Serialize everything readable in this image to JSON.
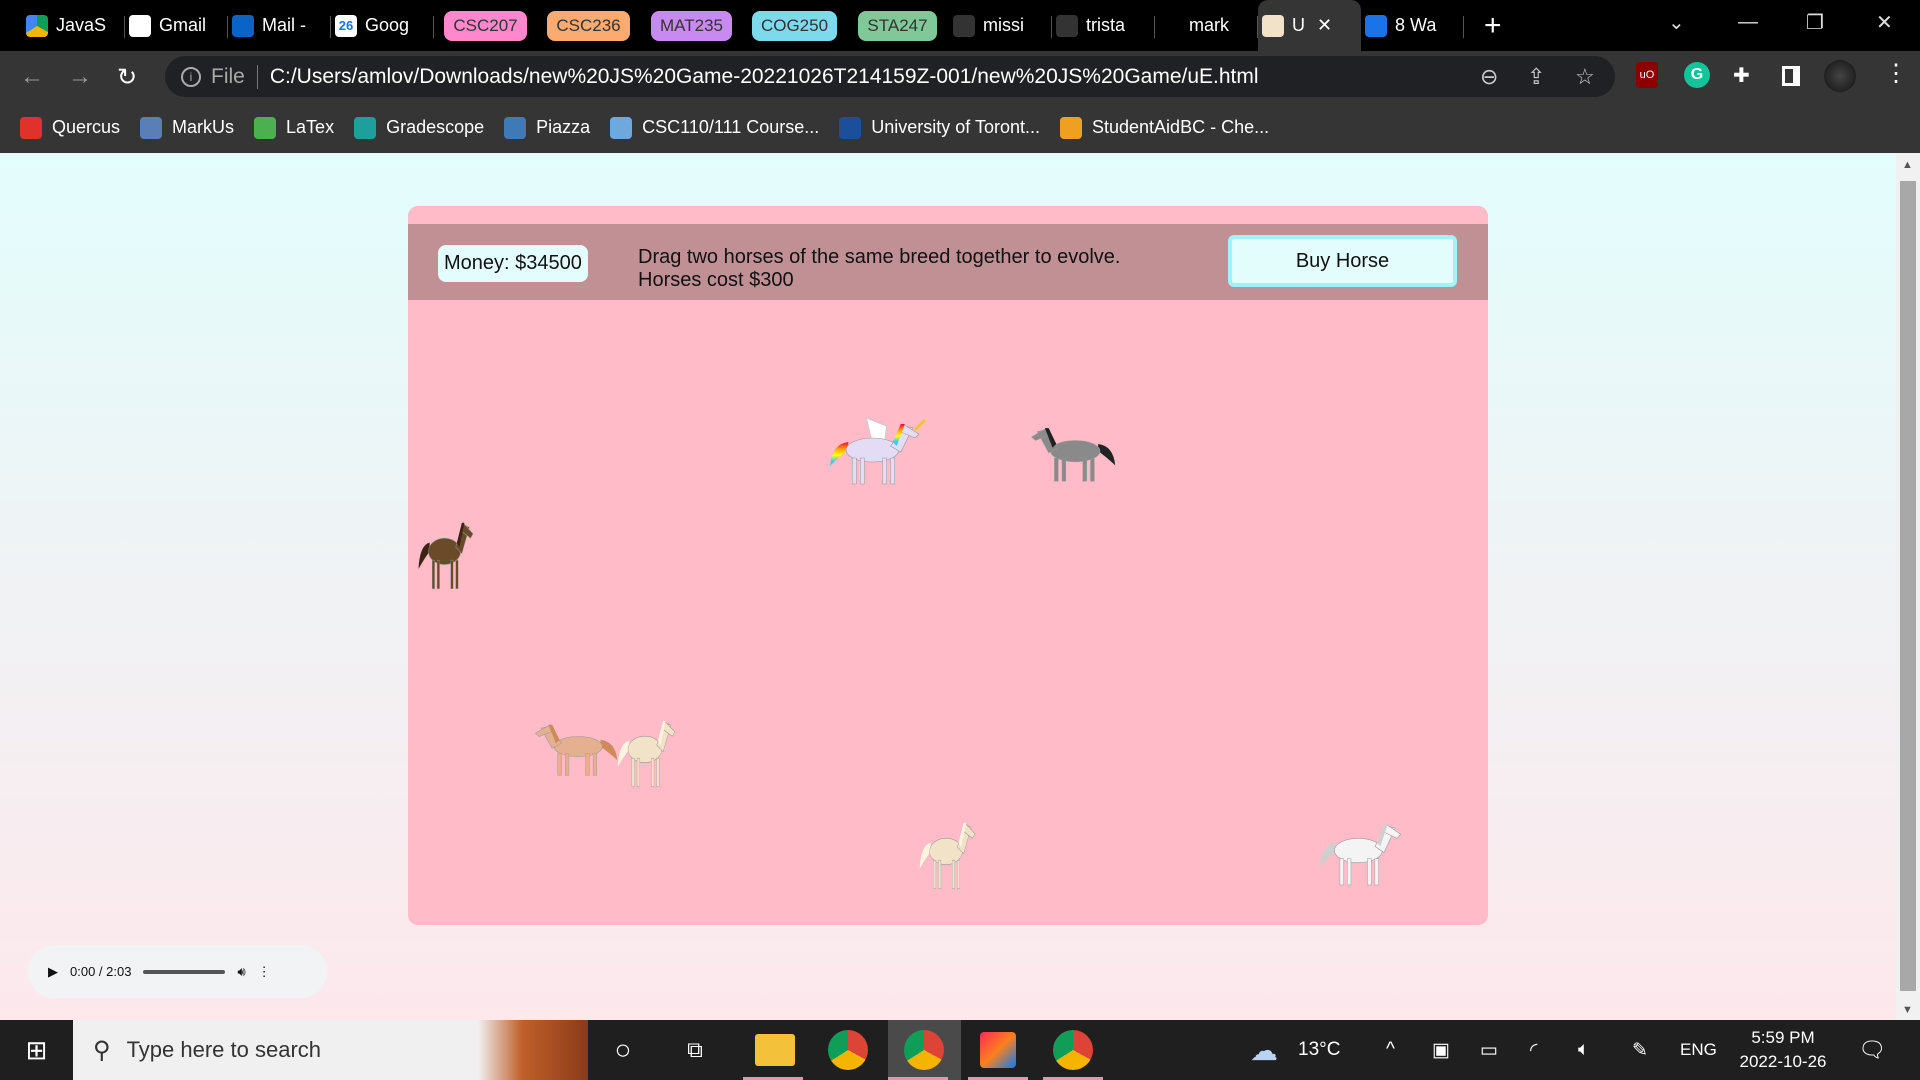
{
  "browser": {
    "tabs": [
      {
        "label": "JavaS",
        "icon": "google-drive-icon"
      },
      {
        "label": "Gmail",
        "icon": "gmail-icon"
      },
      {
        "label": "Mail -",
        "icon": "outlook-icon"
      },
      {
        "label": "Goog",
        "icon": "google-calendar-icon",
        "icon_text": "26"
      },
      {
        "label": "CSC207",
        "pill_color": "#ff88cc"
      },
      {
        "label": "CSC236",
        "pill_color": "#fcab70"
      },
      {
        "label": "MAT235",
        "pill_color": "#c88af0"
      },
      {
        "label": "COG250",
        "pill_color": "#7dd9ec"
      },
      {
        "label": "STA247",
        "pill_color": "#80c897"
      },
      {
        "label": "missi",
        "icon": "github-icon"
      },
      {
        "label": "trista",
        "icon": "github-icon"
      },
      {
        "label": "mark",
        "icon": "stackoverflow-icon"
      },
      {
        "label": "U",
        "icon": "horse-icon",
        "active": true
      },
      {
        "label": "8 Wa",
        "icon": "web-icon"
      }
    ],
    "new_tab": "+",
    "address": {
      "scheme_label": "File",
      "url": "C:/Users/amlov/Downloads/new%20JS%20Game-20221026T214159Z-001/new%20JS%20Game/uE.html"
    },
    "bookmarks": [
      {
        "label": "Quercus",
        "color": "#e0312b"
      },
      {
        "label": "MarkUs",
        "color": "#5a7fb8"
      },
      {
        "label": "LaTex",
        "color": "#4caf50"
      },
      {
        "label": "Gradescope",
        "color": "#1f9e9e"
      },
      {
        "label": "Piazza",
        "color": "#3e7ab8"
      },
      {
        "label": "CSC110/111 Course...",
        "color": "#6fa8dc"
      },
      {
        "label": "University of Toront...",
        "color": "#1b4f9c"
      },
      {
        "label": "StudentAidBC - Che...",
        "color": "#f0a020"
      }
    ]
  },
  "game": {
    "money_label": "Money: $34500",
    "instructions_line1": "Drag two horses of the same breed together to evolve.",
    "instructions_line2": "Horses cost $300",
    "buy_button": "Buy Horse",
    "horses": [
      {
        "breed": "unicorn-pegasus",
        "body": "#e4dcf4",
        "mane": "rainbow"
      },
      {
        "breed": "black-horse",
        "body": "#8a8a8a",
        "mane": "#222222"
      },
      {
        "breed": "clydesdale",
        "body": "#6b4a2a",
        "mane": "#3a2414"
      },
      {
        "breed": "chestnut",
        "body": "#e4b090",
        "mane": "#d08a5a"
      },
      {
        "breed": "cream-pony",
        "body": "#f2e2c8",
        "mane": "#fff4e0"
      },
      {
        "breed": "cream-pony",
        "body": "#f2e2c8",
        "mane": "#fff4e0"
      },
      {
        "breed": "white-horse",
        "body": "#f4f4f4",
        "mane": "#cfcfcf"
      }
    ]
  },
  "audio": {
    "time": "0:00 / 2:03"
  },
  "taskbar": {
    "search_placeholder": "Type here to search",
    "weather": "13°C",
    "language": "ENG",
    "time": "5:59 PM",
    "date": "2022-10-26"
  }
}
